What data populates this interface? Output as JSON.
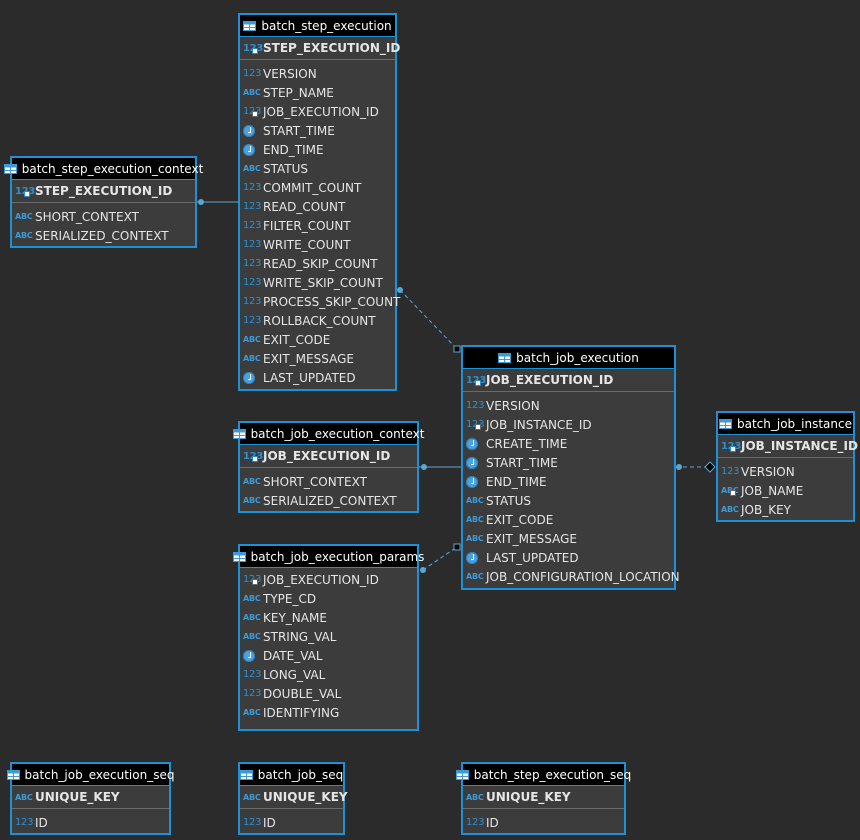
{
  "tables": {
    "batch_step_execution": {
      "title": "batch_step_execution",
      "pk": "STEP_EXECUTION_ID",
      "columns": [
        {
          "type": "num",
          "name": "VERSION"
        },
        {
          "type": "txt",
          "name": "STEP_NAME"
        },
        {
          "type": "fk",
          "name": "JOB_EXECUTION_ID"
        },
        {
          "type": "time",
          "name": "START_TIME"
        },
        {
          "type": "time",
          "name": "END_TIME"
        },
        {
          "type": "txt",
          "name": "STATUS"
        },
        {
          "type": "num",
          "name": "COMMIT_COUNT"
        },
        {
          "type": "num",
          "name": "READ_COUNT"
        },
        {
          "type": "num",
          "name": "FILTER_COUNT"
        },
        {
          "type": "num",
          "name": "WRITE_COUNT"
        },
        {
          "type": "num",
          "name": "READ_SKIP_COUNT"
        },
        {
          "type": "num",
          "name": "WRITE_SKIP_COUNT"
        },
        {
          "type": "num",
          "name": "PROCESS_SKIP_COUNT"
        },
        {
          "type": "num",
          "name": "ROLLBACK_COUNT"
        },
        {
          "type": "txt",
          "name": "EXIT_CODE"
        },
        {
          "type": "txt",
          "name": "EXIT_MESSAGE"
        },
        {
          "type": "time",
          "name": "LAST_UPDATED"
        }
      ]
    },
    "batch_step_execution_context": {
      "title": "batch_step_execution_context",
      "pk": "STEP_EXECUTION_ID",
      "columns": [
        {
          "type": "txt",
          "name": "SHORT_CONTEXT"
        },
        {
          "type": "txt",
          "name": "SERIALIZED_CONTEXT"
        }
      ]
    },
    "batch_job_execution": {
      "title": "batch_job_execution",
      "pk": "JOB_EXECUTION_ID",
      "columns": [
        {
          "type": "num",
          "name": "VERSION"
        },
        {
          "type": "fk",
          "name": "JOB_INSTANCE_ID"
        },
        {
          "type": "time",
          "name": "CREATE_TIME"
        },
        {
          "type": "time",
          "name": "START_TIME"
        },
        {
          "type": "time",
          "name": "END_TIME"
        },
        {
          "type": "txt",
          "name": "STATUS"
        },
        {
          "type": "txt",
          "name": "EXIT_CODE"
        },
        {
          "type": "txt",
          "name": "EXIT_MESSAGE"
        },
        {
          "type": "time",
          "name": "LAST_UPDATED"
        },
        {
          "type": "txt",
          "name": "JOB_CONFIGURATION_LOCATION"
        }
      ]
    },
    "batch_job_instance": {
      "title": "batch_job_instance",
      "pk": "JOB_INSTANCE_ID",
      "columns": [
        {
          "type": "num",
          "name": "VERSION"
        },
        {
          "type": "txtkey",
          "name": "JOB_NAME"
        },
        {
          "type": "txt",
          "name": "JOB_KEY"
        }
      ]
    },
    "batch_job_execution_context": {
      "title": "batch_job_execution_context",
      "pk": "JOB_EXECUTION_ID",
      "columns": [
        {
          "type": "txt",
          "name": "SHORT_CONTEXT"
        },
        {
          "type": "txt",
          "name": "SERIALIZED_CONTEXT"
        }
      ]
    },
    "batch_job_execution_params": {
      "title": "batch_job_execution_params",
      "pk": "",
      "columns": [
        {
          "type": "fk",
          "name": "JOB_EXECUTION_ID"
        },
        {
          "type": "txt",
          "name": "TYPE_CD"
        },
        {
          "type": "txt",
          "name": "KEY_NAME"
        },
        {
          "type": "txt",
          "name": "STRING_VAL"
        },
        {
          "type": "time",
          "name": "DATE_VAL"
        },
        {
          "type": "num",
          "name": "LONG_VAL"
        },
        {
          "type": "num",
          "name": "DOUBLE_VAL"
        },
        {
          "type": "txt",
          "name": "IDENTIFYING"
        }
      ]
    },
    "batch_job_execution_seq": {
      "title": "batch_job_execution_seq",
      "pk": "UNIQUE_KEY",
      "pk_type": "txt",
      "columns": [
        {
          "type": "num",
          "name": "ID"
        }
      ]
    },
    "batch_job_seq": {
      "title": "batch_job_seq",
      "pk": "UNIQUE_KEY",
      "pk_type": "txt",
      "columns": [
        {
          "type": "num",
          "name": "ID"
        }
      ]
    },
    "batch_step_execution_seq": {
      "title": "batch_step_execution_seq",
      "pk": "UNIQUE_KEY",
      "pk_type": "txt",
      "columns": [
        {
          "type": "num",
          "name": "ID"
        }
      ]
    }
  },
  "colors": {
    "background": "#2b2b2b",
    "table_border": "#1e90d6",
    "table_body": "#3c3c3c",
    "header": "#000000",
    "link": "#5aa7d6"
  }
}
